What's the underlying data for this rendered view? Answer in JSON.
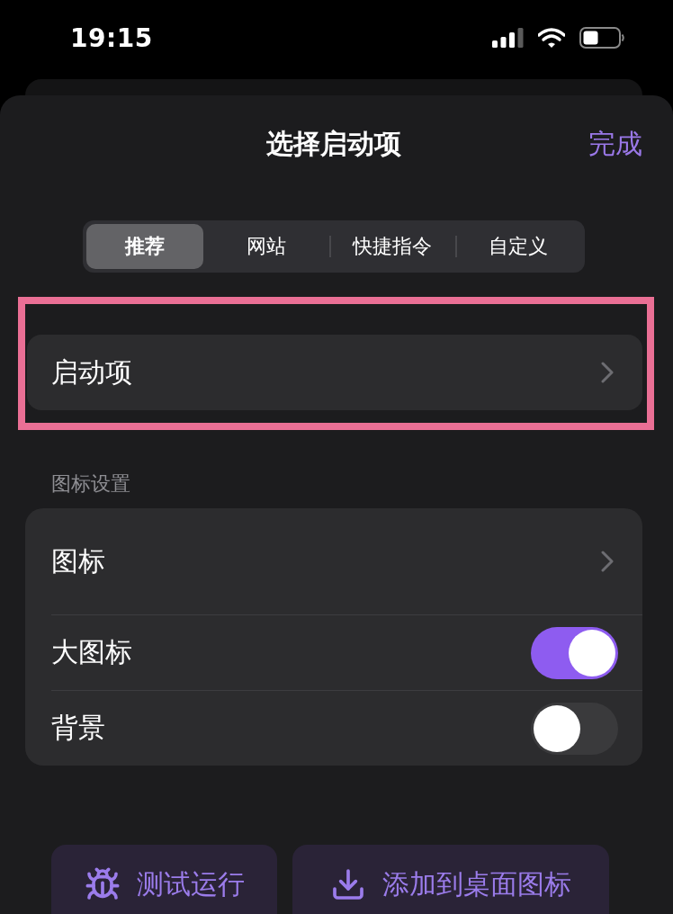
{
  "status_bar": {
    "time": "19:15"
  },
  "sheet": {
    "title": "选择启动项",
    "done": "完成"
  },
  "tabs": [
    {
      "label": "推荐",
      "selected": true
    },
    {
      "label": "网站",
      "selected": false
    },
    {
      "label": "快捷指令",
      "selected": false
    },
    {
      "label": "自定义",
      "selected": false
    }
  ],
  "launch_item": {
    "label": "启动项",
    "highlighted": true
  },
  "icon_settings": {
    "header": "图标设置",
    "rows": [
      {
        "kind": "link",
        "label": "图标"
      },
      {
        "kind": "toggle",
        "label": "大图标",
        "on": true
      },
      {
        "kind": "toggle",
        "label": "背景",
        "on": false
      }
    ]
  },
  "actions": [
    {
      "kind": "test_run",
      "label": "测试运行"
    },
    {
      "kind": "add_to_home",
      "label": "添加到桌面图标"
    }
  ]
}
